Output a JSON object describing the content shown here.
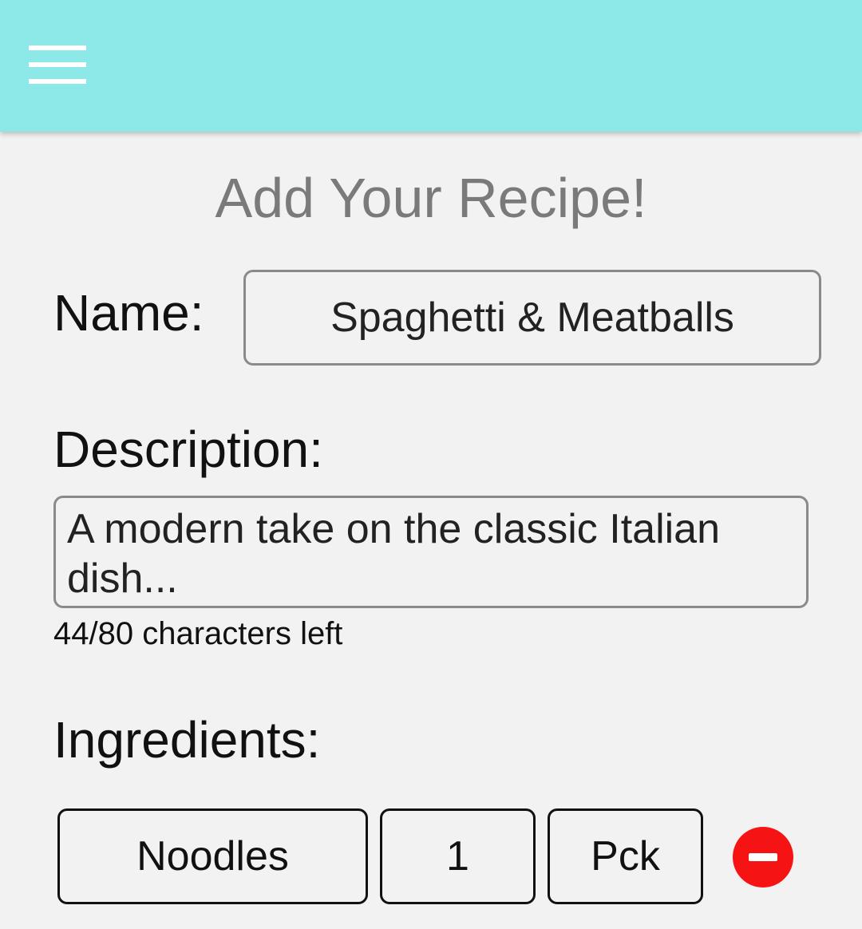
{
  "header": {
    "menu_icon": "hamburger-menu-icon",
    "background_color": "#8de9e8"
  },
  "page": {
    "title": "Add Your Recipe!"
  },
  "form": {
    "name_label": "Name:",
    "name_value": "Spaghetti & Meatballs",
    "description_label": "Description:",
    "description_value": "A modern take on the classic Italian dish...",
    "char_count": "44/80 characters left",
    "ingredients_label": "Ingredients:"
  },
  "ingredients": [
    {
      "name": "Noodles",
      "quantity": "1",
      "unit": "Pck",
      "remove_icon": "minus-circle-icon",
      "remove_color": "#f51313"
    }
  ]
}
